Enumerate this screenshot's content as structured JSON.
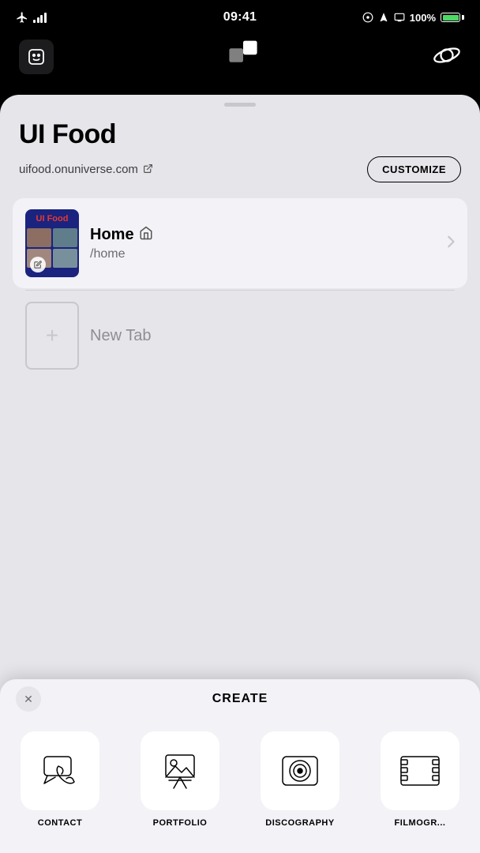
{
  "statusBar": {
    "time": "09:41",
    "battery": "100%"
  },
  "appBar": {
    "smileyIcon": "🤖",
    "logoText": "✦",
    "planetIcon": "🪐"
  },
  "site": {
    "title": "UI Food",
    "url": "uifood.onuniverse.com",
    "customizeLabel": "CUSTOMIZE"
  },
  "tabs": [
    {
      "name": "Home",
      "path": "/home",
      "nameIcon": "🏠"
    }
  ],
  "newTab": {
    "label": "New Tab"
  },
  "createSheet": {
    "title": "CREATE",
    "closeIcon": "✕",
    "options": [
      {
        "label": "CONTACT",
        "iconType": "chat"
      },
      {
        "label": "PORTFOLIO",
        "iconType": "portfolio"
      },
      {
        "label": "DISCOGRAPHY",
        "iconType": "discography"
      },
      {
        "label": "FILMOGR...",
        "iconType": "film"
      }
    ]
  }
}
